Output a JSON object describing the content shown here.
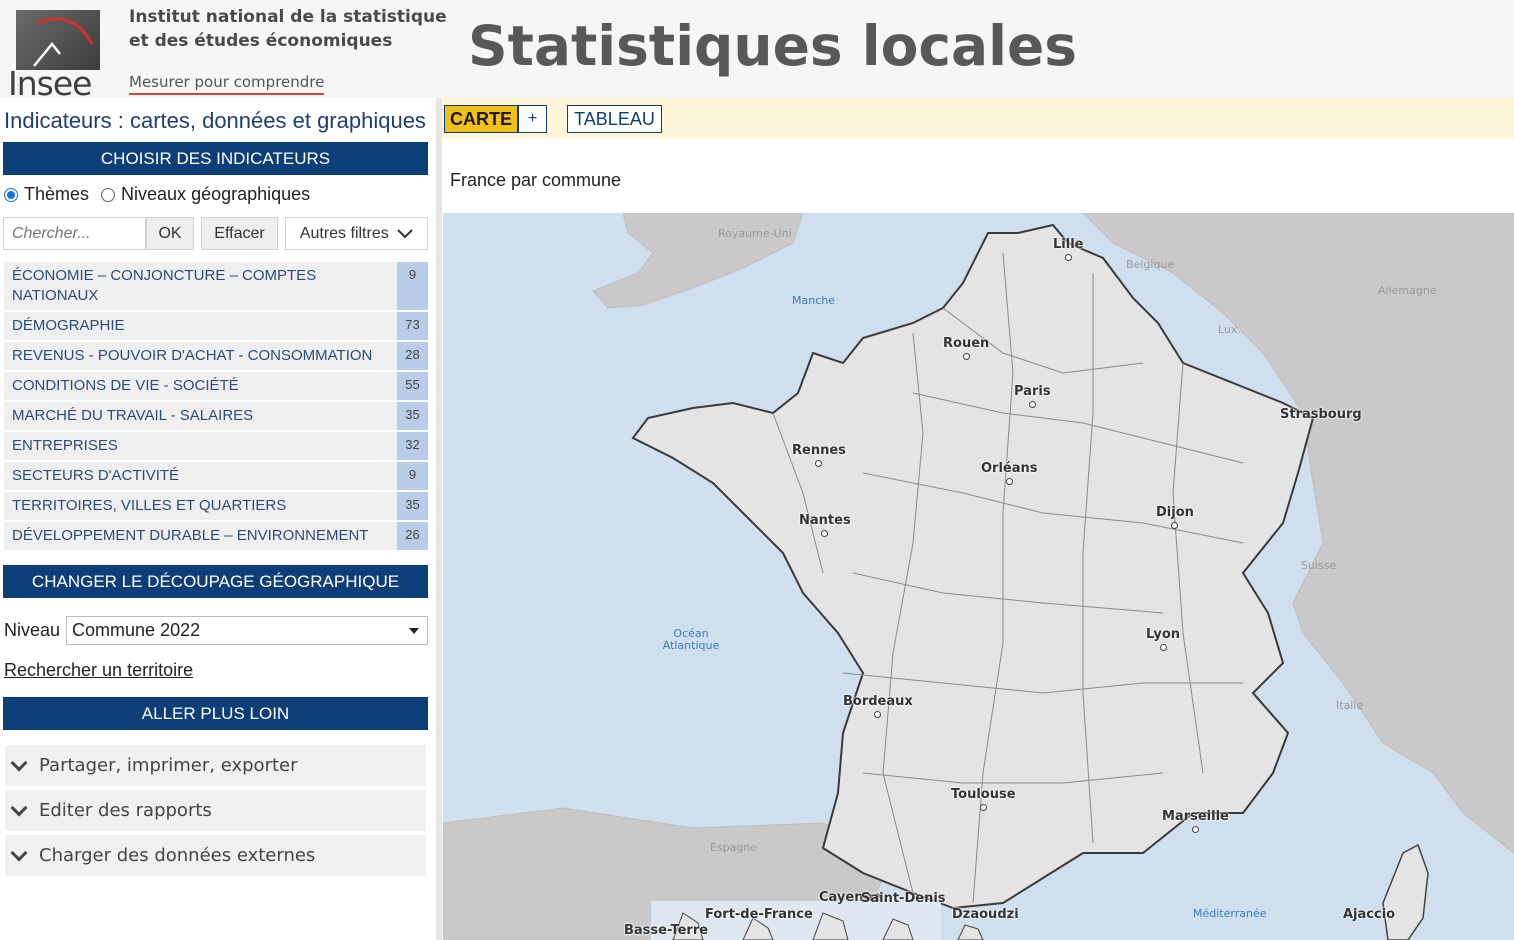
{
  "header": {
    "logo_word": "Insee",
    "institute_line1": "Institut national de la statistique",
    "institute_line2": "et des études économiques",
    "tagline": "Mesurer pour comprendre",
    "site_title": "Statistiques locales"
  },
  "left_panel": {
    "title": "Indicateurs : cartes, données et graphiques",
    "choose_indicators": "CHOISIR DES INDICATEURS",
    "radio_themes": "Thèmes",
    "radio_levels": "Niveaux géographiques",
    "radio_selected": "themes",
    "search_placeholder": "Chercher...",
    "ok_label": "OK",
    "clear_label": "Effacer",
    "filters_label": "Autres filtres",
    "themes": [
      {
        "name": "ÉCONOMIE – CONJONCTURE – COMPTES NATIONAUX",
        "count": "9"
      },
      {
        "name": "DÉMOGRAPHIE",
        "count": "73"
      },
      {
        "name": "REVENUS - POUVOIR D'ACHAT - CONSOMMATION",
        "count": "28"
      },
      {
        "name": "CONDITIONS DE VIE - SOCIÉTÉ",
        "count": "55"
      },
      {
        "name": "MARCHÉ DU TRAVAIL - SALAIRES",
        "count": "35"
      },
      {
        "name": "ENTREPRISES",
        "count": "32"
      },
      {
        "name": "SECTEURS D'ACTIVITÉ",
        "count": "9"
      },
      {
        "name": "TERRITOIRES, VILLES ET QUARTIERS",
        "count": "35"
      },
      {
        "name": "DÉVELOPPEMENT DURABLE – ENVIRONNEMENT",
        "count": "26"
      }
    ],
    "change_geo": "CHANGER LE DÉCOUPAGE GÉOGRAPHIQUE",
    "niveau_label": "Niveau",
    "niveau_value": "Commune 2022",
    "search_territory": "Rechercher un territoire",
    "go_further": "ALLER PLUS LOIN",
    "accordions": [
      "Partager, imprimer, exporter",
      "Editer des rapports",
      "Charger des données externes"
    ]
  },
  "toolbar": {
    "carte": "CARTE",
    "plus": "+",
    "tableau": "TABLEAU"
  },
  "map": {
    "caption": "France par commune",
    "cities": [
      "Lille",
      "Rouen",
      "Paris",
      "Strasbourg",
      "Rennes",
      "Orléans",
      "Nantes",
      "Dijon",
      "Lyon",
      "Bordeaux",
      "Toulouse",
      "Marseille",
      "Ajaccio"
    ],
    "countries": [
      "Royaume-Uni",
      "Belgique",
      "Allemagne",
      "Lux.",
      "Suisse",
      "Italie",
      "Espagne"
    ],
    "seas": [
      "Manche",
      "Océan Atlantique",
      "Méditerranée"
    ],
    "overseas": [
      "Basse-Terre",
      "Fort-de-France",
      "Cayenne",
      "Saint-Denis",
      "Dzaoudzi"
    ],
    "colors": {
      "sea": "#cfdfee",
      "land": "#c9c9c9",
      "france": "#e4e4e4",
      "accent": "#0d3e78",
      "active_tab": "#f3bf1b"
    }
  }
}
